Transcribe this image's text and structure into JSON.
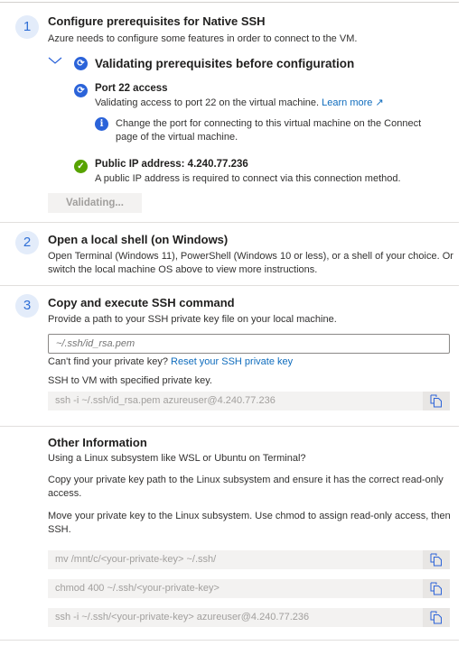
{
  "step1": {
    "number": "1",
    "title": "Configure prerequisites for Native SSH",
    "description": "Azure needs to configure some features in order to connect to the VM.",
    "validating_header": "Validating prerequisites before configuration",
    "port": {
      "title": "Port 22 access",
      "description": "Validating access to port 22 on the virtual machine.",
      "link": "Learn more",
      "info": "Change the port for connecting to this virtual machine on the Connect page of the virtual machine."
    },
    "ip": {
      "title": "Public IP address: 4.240.77.236",
      "description": "A public IP address is required to connect via this connection method."
    },
    "button": "Validating..."
  },
  "step2": {
    "number": "2",
    "title": "Open a local shell (on Windows)",
    "description": "Open Terminal (Windows 11), PowerShell (Windows 10 or less), or a shell of your choice. Or switch the local machine OS above to view more instructions."
  },
  "step3": {
    "number": "3",
    "title": "Copy and execute SSH command",
    "description": "Provide a path to your SSH private key file on your local machine.",
    "input_placeholder": "~/.ssh/id_rsa.pem",
    "reset_prompt": "Can't find your private key?",
    "reset_link": "Reset your SSH private key",
    "ssh_label": "SSH to VM with specified private key.",
    "command": "ssh -i ~/.ssh/id_rsa.pem azureuser@4.240.77.236"
  },
  "other": {
    "title": "Other Information",
    "q": "Using a Linux subsystem like WSL or Ubuntu on Terminal?",
    "p1": "Copy your private key path to the Linux subsystem and ensure it has the correct read-only access.",
    "p2": "Move your private key to the Linux subsystem. Use chmod to assign read-only access, then SSH.",
    "commands": [
      "mv /mnt/c/<your-private-key> ~/.ssh/",
      "chmod 400 ~/.ssh/<your-private-key>",
      "ssh -i ~/.ssh/<your-private-key> azureuser@4.240.77.236"
    ]
  },
  "colors": {
    "accent": "#0f6cbd",
    "success": "#57a300",
    "sync": "#2b63d9"
  }
}
